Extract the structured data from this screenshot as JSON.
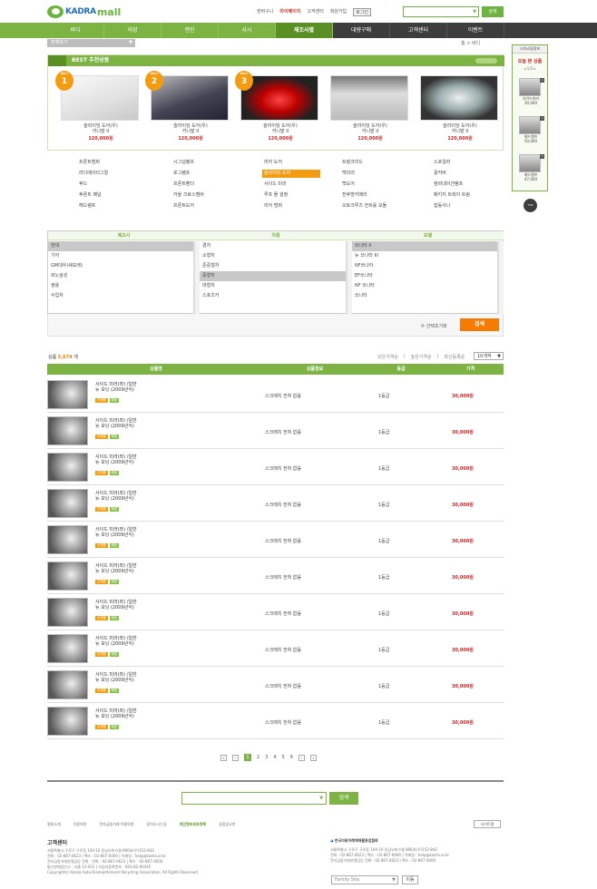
{
  "header": {
    "logo_text_1": "KADRA",
    "logo_text_2": "mall",
    "links": [
      "장바구니",
      "마이페이지",
      "고객센터",
      "회원가입",
      "로그인"
    ],
    "search_button": "검색"
  },
  "nav": {
    "items": [
      "바디",
      "의장",
      "엔진",
      "샤시",
      "제조사별",
      "대량구매",
      "고객센터",
      "이벤트"
    ],
    "active": "제조사별"
  },
  "subbar": {
    "select_label": "전체보기",
    "breadcrumb": "홈 > 바디"
  },
  "best": {
    "title": "BEST 추천상품",
    "rank_label": "BEST",
    "products": [
      {
        "rank": "1",
        "name": "슬라이딩 도어(우)",
        "sub": "카니발 II",
        "price": "120,000원"
      },
      {
        "rank": "2",
        "name": "슬라이딩 도어(우)",
        "sub": "카니발 II",
        "price": "120,000원"
      },
      {
        "rank": "3",
        "name": "슬라이딩 도어(우)",
        "sub": "카니발 II",
        "price": "120,000원"
      },
      {
        "rank": "",
        "name": "슬라이딩 도어(우)",
        "sub": "카니발 II",
        "price": "120,000원"
      },
      {
        "rank": "",
        "name": "슬라이딩 도어(우)",
        "sub": "카니발 II",
        "price": "120,000원"
      }
    ]
  },
  "categories": [
    [
      "프론트범퍼",
      "시그널램프",
      "리어 도어",
      "트렁크리드",
      "스포일러"
    ],
    [
      "라디에이터그릴",
      "포그램프",
      "슬라이딩 도어",
      "백미러",
      "휠커버"
    ],
    [
      "후드",
      "프론트펜더",
      "사이드 미러",
      "백도어",
      "컴비네이션램프"
    ],
    [
      "후론트 패널",
      "카울 크로스멤버",
      "루프 몰 설정",
      "전후방카메라",
      "패키지 트레이 트림"
    ],
    [
      "헤드램프",
      "프론트도어",
      "리어 범퍼",
      "오토크루즈 컨트롤 모듈",
      "잡동사니"
    ]
  ],
  "category_selected": "슬라이딩 도어",
  "selector": {
    "headers": [
      "제조사",
      "차종",
      "모델"
    ],
    "makers": [
      "현대",
      "기아",
      "GM대우(쉐보레)",
      "르노삼성",
      "쌍용",
      "수입차"
    ],
    "makers_selected": "현대",
    "types": [
      "경차",
      "소형차",
      "준중형차",
      "중형차",
      "대형차",
      "스포츠카"
    ],
    "types_selected": "중형차",
    "models": [
      "쏘나타 II",
      "뉴 쏘나타 III",
      "NF쏘나타",
      "EF쏘나타",
      "NF 쏘나타",
      "쏘나타"
    ],
    "models_selected": "쏘나타 II",
    "reset": "선택초기화",
    "search": "검색"
  },
  "list": {
    "count_label": "상품",
    "count_value": "5,674",
    "count_unit": "개",
    "sort": [
      "낮은가격순",
      "높은가격순",
      "최신등록순"
    ],
    "per_page": "10개씩",
    "columns": [
      "상품명",
      "상품정보",
      "등급",
      "가격"
    ],
    "rows": [
      {
        "name": "사이드 미러(좌) /일반\n뉴 모닝 (2009년식)",
        "info": "스크래치 전혀 없음",
        "grade": "1등급",
        "price": "30,000원"
      },
      {
        "name": "사이드 미러(좌) /일반\n뉴 모닝 (2009년식)",
        "info": "스크래치 전혀 없음",
        "grade": "1등급",
        "price": "30,000원"
      },
      {
        "name": "사이드 미러(좌) /일반\n뉴 모닝 (2009년식)",
        "info": "스크래치 전혀 없음",
        "grade": "1등급",
        "price": "30,000원"
      },
      {
        "name": "사이드 미러(좌) /일반\n뉴 모닝 (2009년식)",
        "info": "스크래치 전혀 없음",
        "grade": "1등급",
        "price": "30,000원"
      },
      {
        "name": "사이드 미러(좌) /일반\n뉴 모닝 (2009년식)",
        "info": "스크래치 전혀 없음",
        "grade": "1등급",
        "price": "30,000원"
      },
      {
        "name": "사이드 미러(좌) /일반\n뉴 모닝 (2009년식)",
        "info": "스크래치 전혀 없음",
        "grade": "1등급",
        "price": "30,000원"
      },
      {
        "name": "사이드 미러(좌) /일반\n뉴 모닝 (2009년식)",
        "info": "스크래치 전혀 없음",
        "grade": "1등급",
        "price": "30,000원"
      },
      {
        "name": "사이드 미러(좌) /일반\n뉴 모닝 (2009년식)",
        "info": "스크래치 전혀 없음",
        "grade": "1등급",
        "price": "30,000원"
      },
      {
        "name": "사이드 미러(좌) /일반\n뉴 모닝 (2009년식)",
        "info": "스크래치 전혀 없음",
        "grade": "1등급",
        "price": "30,000원"
      },
      {
        "name": "사이드 미러(좌) /일반\n뉴 모닝 (2009년식)",
        "info": "스크래치 전혀 없음",
        "grade": "1등급",
        "price": "30,000원"
      }
    ],
    "badges": [
      "신제품",
      "배송"
    ]
  },
  "pager": {
    "pages": [
      "1",
      "2",
      "3",
      "4",
      "5",
      "6"
    ],
    "current": "1"
  },
  "bottom_search": {
    "button": "검색"
  },
  "footer": {
    "links": [
      "협회소개",
      "이용약관",
      "전자금융거래 이용약관",
      "찾아오시는길",
      "개인정보보호정책",
      "상점입고안"
    ],
    "highlight": "개인정보보호정책",
    "sitemap": "사이트맵",
    "cs_title": "고객센터",
    "cs_lines": [
      "서울특별시 구로구 구로동 104-10 동남오피스텔 806호(우)152-842",
      "전화 : 02-867-0623 | 팩스 : 02-867-0000 | 이메일 : help@kadra.or.kr",
      "전자금융거래분쟁담당 전화 : 전화 : 02-867-0623 | 팩스 : 02-867-0000",
      "통신판매업신고 : 서울 12-023 | 사업자등록번호 : 820-82-00345",
      "Copyright(c) Korea Auto Dismantlement Recycling Association.  All Rights Reserved"
    ],
    "assoc_title": "한국자동차해체재활용업협회",
    "assoc_lines": [
      "서울특별시 구로구 구로동 104-10 동남오피스텔 806호(우)152-842",
      "전화 : 02-867-0623 | 팩스 : 02-867-0000 | 이메일 : help@kadra.or.kr",
      "전자금융거래분쟁담당 전화 : 02-867-0623 | 팩스 : 02-867-0000"
    ],
    "family_site": "Family Site",
    "family_go": "이동"
  },
  "sidebar": {
    "header": "나의쇼핑정보",
    "title": "오늘 본 상품",
    "page": "1/3",
    "items": [
      {
        "name": "사이드미러",
        "price": "20,000"
      },
      {
        "name": "헤드램프",
        "price": "50,000"
      },
      {
        "name": "헤드램프",
        "price": "47,000"
      }
    ],
    "top": "TOP"
  }
}
